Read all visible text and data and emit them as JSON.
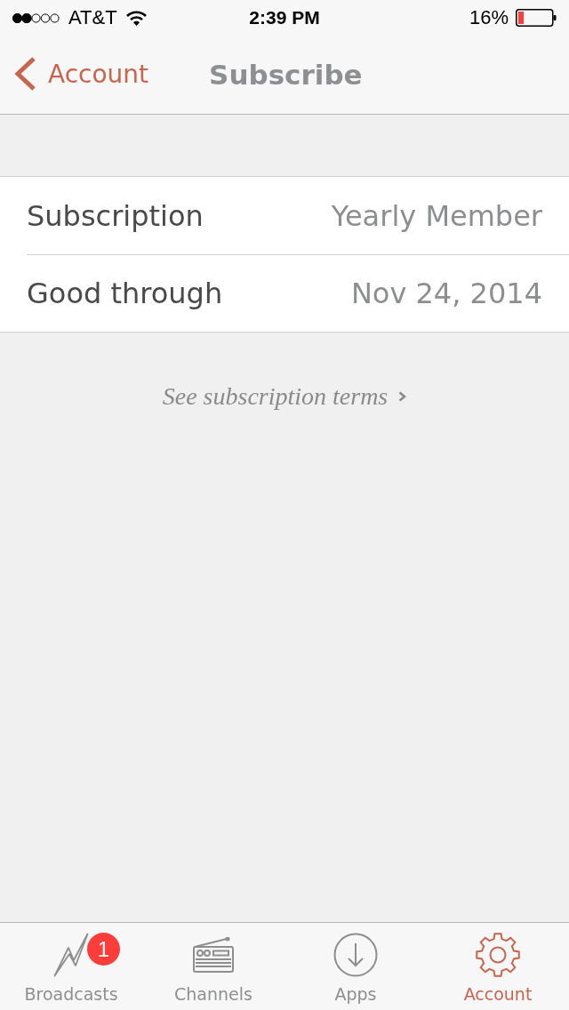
{
  "status_bar": {
    "carrier": "AT&T",
    "time": "2:39 PM",
    "battery": "16%"
  },
  "nav_bar": {
    "back": "Account",
    "title": "Subscribe"
  },
  "rows": [
    {
      "label": "Subscription",
      "value": "Yearly Member"
    },
    {
      "label": "Good through",
      "value": "Nov 24, 2014"
    }
  ],
  "terms_link": "See subscription terms",
  "tabs": [
    {
      "label": "Broadcasts",
      "selected": false,
      "badge": "1"
    },
    {
      "label": "Channels",
      "selected": false
    },
    {
      "label": "Apps",
      "selected": false
    },
    {
      "label": "Account",
      "selected": true
    }
  ]
}
